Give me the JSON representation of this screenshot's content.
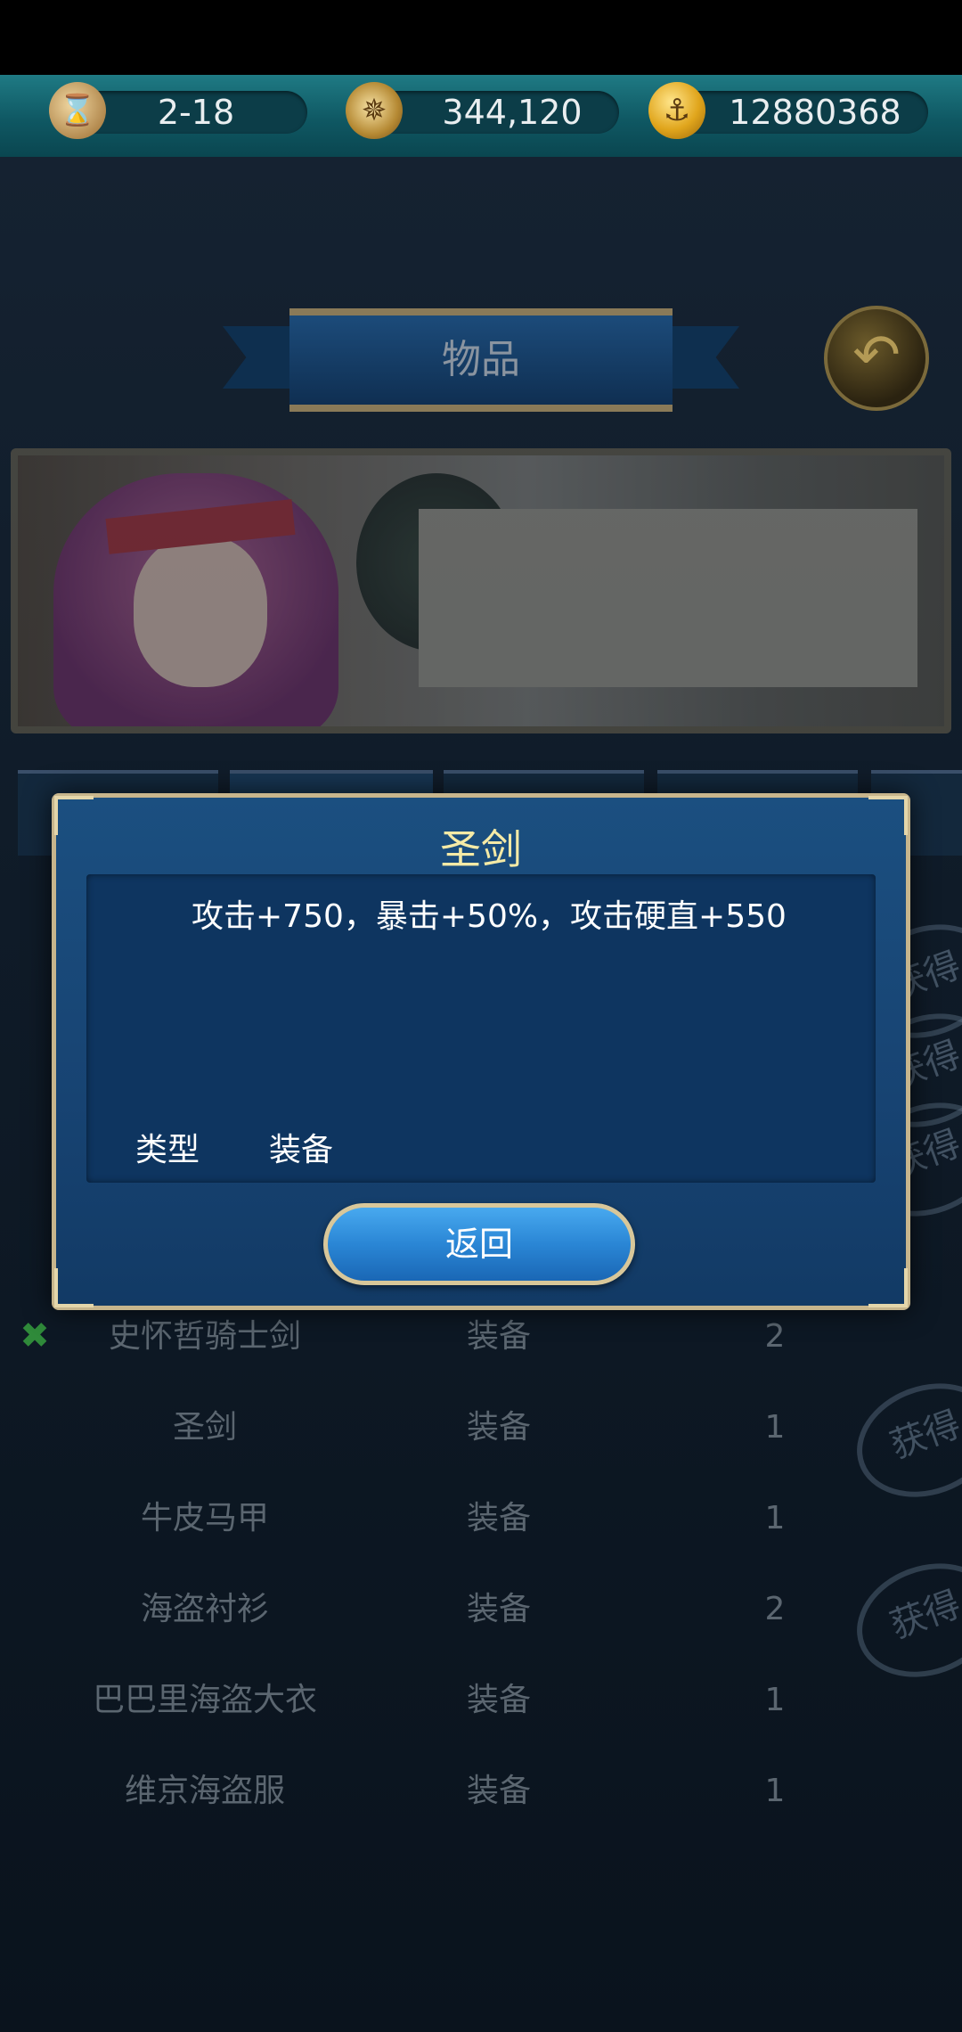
{
  "resources": [
    {
      "icon": "hourglass-icon",
      "value": "2-18"
    },
    {
      "icon": "compass-icon",
      "value": "344,120"
    },
    {
      "icon": "gold-coin-icon",
      "value": "12880368"
    }
  ],
  "page": {
    "title": "物品"
  },
  "list": {
    "rows": [
      {
        "name": "史怀哲骑士剑",
        "type": "装备",
        "count": "2"
      },
      {
        "name": "圣剑",
        "type": "装备",
        "count": "1"
      },
      {
        "name": "牛皮马甲",
        "type": "装备",
        "count": "1"
      },
      {
        "name": "海盗衬衫",
        "type": "装备",
        "count": "2"
      },
      {
        "name": "巴巴里海盗大衣",
        "type": "装备",
        "count": "1"
      },
      {
        "name": "维京海盗服",
        "type": "装备",
        "count": "1"
      }
    ],
    "stamp_text": "获得"
  },
  "modal": {
    "title": "圣剑",
    "description": "攻击+750，暴击+50%，攻击硬直+550",
    "type_label": "类型",
    "type_value": "装备",
    "return_label": "返回"
  }
}
